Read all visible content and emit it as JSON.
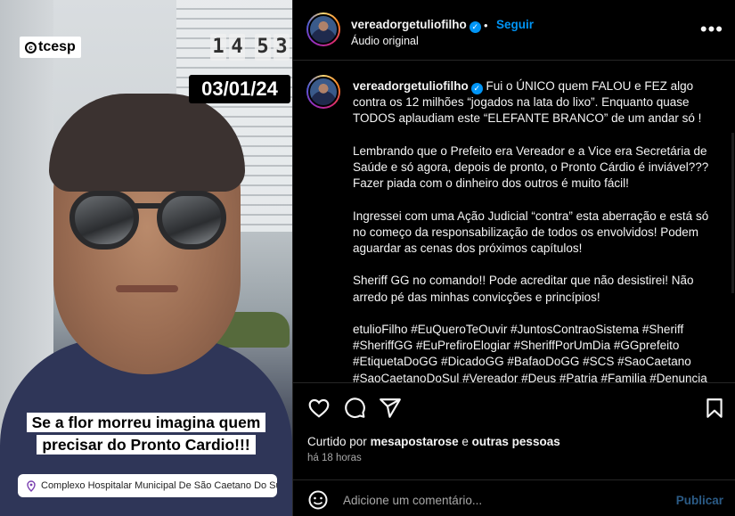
{
  "media": {
    "watermark": "tcesp",
    "clock_digits": [
      "1",
      "4",
      "5",
      "3"
    ],
    "date": "03/01/24",
    "caption_line1": "Se a flor morreu imagina quem",
    "caption_line2": "precisar do Pronto Cardio!!!",
    "location": "Complexo Hospitalar Municipal De São Caetano Do Sul"
  },
  "header": {
    "username": "vereadorgetuliofilho",
    "separator": "•",
    "follow_label": "Seguir",
    "audio": "Áudio original",
    "more_icon": "more-horizontal-icon"
  },
  "caption": {
    "username": "vereadorgetuliofilho",
    "paragraphs": [
      "Fui o ÚNICO quem FALOU e FEZ algo contra os 12 milhões “jogados na lata do lixo”. Enquanto quase TODOS aplaudiam este “ELEFANTE BRANCO” de um andar só !",
      "Lembrando que o Prefeito era Vereador e a Vice era Secretária de Saúde e só agora, depois de pronto, o Pronto Cárdio é inviável??? Fazer piada com o dinheiro dos outros é muito fácil!",
      "Ingressei com uma Ação Judicial “contra” esta aberração e está só no começo da responsabilização de todos os envolvidos! Podem aguardar as cenas dos próximos capítulos!",
      "Sheriff GG no comando!! Pode acreditar que não desistirei! Não arredo pé das minhas convicções e princípios!"
    ],
    "hashtags": "etulioFilho #EuQueroTeOuvir #JuntosContraoSistema #Sheriff #SheriffGG #EuPrefiroElogiar #SheriffPorUmDia #GGprefeito #EtiquetaDoGG #DicadoGG #BafaoDoGG #SCS #SaoCaetano #SaoCaetanoDoSul #Vereador #Deus #Patria #Familia #Denuncia"
  },
  "actions": {
    "icons": [
      "heart-icon",
      "comment-icon",
      "share-icon",
      "bookmark-icon"
    ]
  },
  "likes": {
    "prefix": "Curtido por",
    "user": "mesapostarose",
    "conj": "e",
    "others": "outras pessoas"
  },
  "time_ago": "há 18 horas",
  "composer": {
    "placeholder": "Adicione um comentário...",
    "publish_label": "Publicar"
  },
  "colors": {
    "accent": "#0095f6",
    "publish_disabled": "#2b5b86",
    "muted": "#a8a8a8"
  }
}
